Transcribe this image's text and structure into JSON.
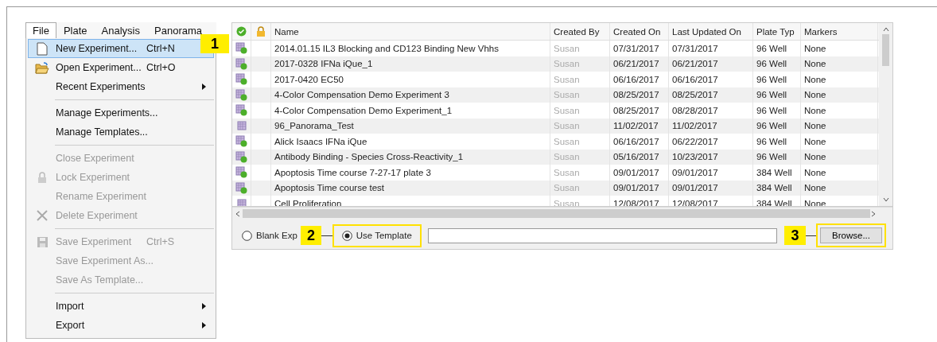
{
  "menubar": [
    {
      "label": "File",
      "selected": true
    },
    {
      "label": "Plate",
      "selected": false
    },
    {
      "label": "Analysis",
      "selected": false
    },
    {
      "label": "Panorama",
      "selected": false
    }
  ],
  "file_menu": [
    {
      "kind": "item",
      "label": "New Experiment...",
      "shortcut": "Ctrl+N",
      "selected": true,
      "disabled": false,
      "submenu": false
    },
    {
      "kind": "item",
      "label": "Open Experiment...",
      "shortcut": "Ctrl+O",
      "selected": false,
      "disabled": false,
      "submenu": false
    },
    {
      "kind": "item",
      "label": "Recent Experiments",
      "selected": false,
      "disabled": false,
      "submenu": true
    },
    {
      "kind": "separator"
    },
    {
      "kind": "item",
      "label": "Manage Experiments...",
      "selected": false,
      "disabled": false,
      "submenu": false
    },
    {
      "kind": "item",
      "label": "Manage Templates...",
      "selected": false,
      "disabled": false,
      "submenu": false
    },
    {
      "kind": "separator"
    },
    {
      "kind": "item",
      "label": "Close Experiment",
      "selected": false,
      "disabled": true,
      "submenu": false
    },
    {
      "kind": "item",
      "label": "Lock Experiment",
      "selected": false,
      "disabled": true,
      "submenu": false
    },
    {
      "kind": "item",
      "label": "Rename Experiment",
      "selected": false,
      "disabled": true,
      "submenu": false
    },
    {
      "kind": "item",
      "label": "Delete Experiment",
      "selected": false,
      "disabled": true,
      "submenu": false
    },
    {
      "kind": "separator"
    },
    {
      "kind": "item",
      "label": "Save Experiment",
      "shortcut": "Ctrl+S",
      "selected": false,
      "disabled": true,
      "submenu": false
    },
    {
      "kind": "item",
      "label": "Save Experiment As...",
      "selected": false,
      "disabled": true,
      "submenu": false
    },
    {
      "kind": "item",
      "label": "Save  As Template...",
      "selected": false,
      "disabled": true,
      "submenu": false
    },
    {
      "kind": "separator"
    },
    {
      "kind": "item",
      "label": "Import",
      "selected": false,
      "disabled": false,
      "submenu": true
    },
    {
      "kind": "item",
      "label": "Export",
      "selected": false,
      "disabled": false,
      "submenu": true
    }
  ],
  "table": {
    "columns": [
      "Name",
      "Created By",
      "Created On",
      "Last Updated On",
      "Plate Typ",
      "Markers"
    ],
    "rows": [
      {
        "kind": "plate-ok",
        "cells": [
          "2014.01.15 IL3 Blocking and CD123 Binding New Vhhs",
          "Susan",
          "07/31/2017",
          "07/31/2017",
          "96 Well",
          "None"
        ]
      },
      {
        "kind": "plate-ok",
        "cells": [
          "2017-0328 IFNa iQue_1",
          "Susan",
          "06/21/2017",
          "06/21/2017",
          "96 Well",
          "None"
        ]
      },
      {
        "kind": "plate-ok",
        "cells": [
          "2017-0420 EC50",
          "Susan",
          "06/16/2017",
          "06/16/2017",
          "96 Well",
          "None"
        ]
      },
      {
        "kind": "plate-ok",
        "cells": [
          "4-Color Compensation Demo Experiment 3",
          "Susan",
          "08/25/2017",
          "08/25/2017",
          "96 Well",
          "None"
        ]
      },
      {
        "kind": "plate-ok",
        "cells": [
          "4-Color Compensation Demo Experiment_1",
          "Susan",
          "08/25/2017",
          "08/28/2017",
          "96 Well",
          "None"
        ]
      },
      {
        "kind": "plate",
        "cells": [
          "96_Panorama_Test",
          "Susan",
          "11/02/2017",
          "11/02/2017",
          "96 Well",
          "None"
        ]
      },
      {
        "kind": "plate-ok",
        "cells": [
          "Alick Isaacs IFNa iQue",
          "Susan",
          "06/16/2017",
          "06/22/2017",
          "96 Well",
          "None"
        ]
      },
      {
        "kind": "plate-ok",
        "cells": [
          "Antibody Binding - Species Cross-Reactivity_1",
          "Susan",
          "05/16/2017",
          "10/23/2017",
          "96 Well",
          "None"
        ]
      },
      {
        "kind": "plate-ok",
        "cells": [
          "Apoptosis Time course 7-27-17 plate 3",
          "Susan",
          "09/01/2017",
          "09/01/2017",
          "384 Well",
          "None"
        ]
      },
      {
        "kind": "plate-ok",
        "cells": [
          "Apoptosis Time course test",
          "Susan",
          "09/01/2017",
          "09/01/2017",
          "384 Well",
          "None"
        ]
      },
      {
        "kind": "plate",
        "cells": [
          "Cell Proliferation",
          "Susan",
          "12/08/2017",
          "12/08/2017",
          "384 Well",
          "None"
        ]
      }
    ]
  },
  "options": [
    {
      "label": "Blank Exp",
      "selected": false
    },
    {
      "label": "Use Template",
      "selected": true
    }
  ],
  "browse_button": "Browse...",
  "callouts": [
    "1",
    "2",
    "3"
  ]
}
